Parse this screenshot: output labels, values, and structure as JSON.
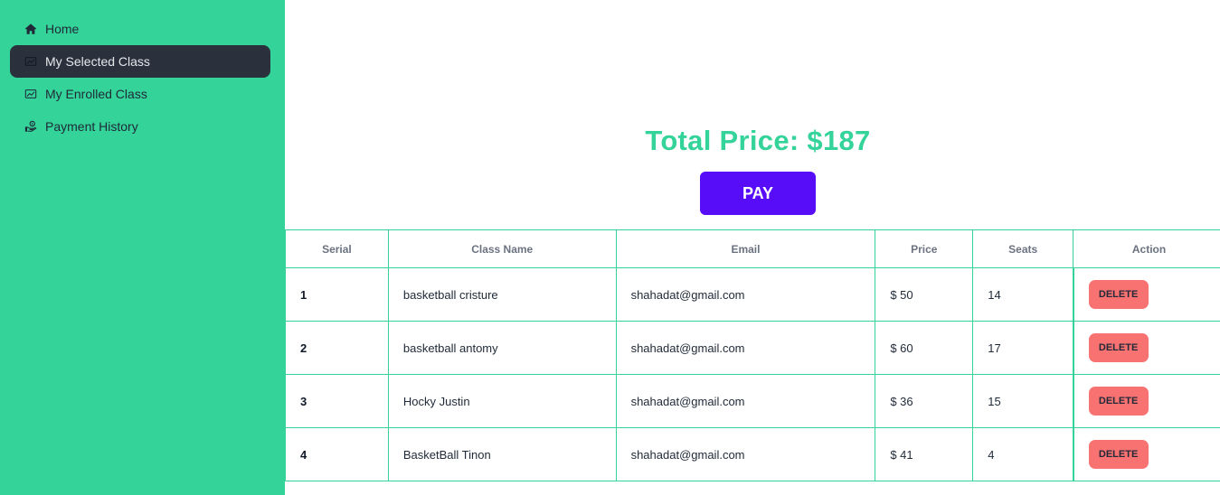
{
  "sidebar": {
    "items": [
      {
        "label": "Home",
        "icon": "home-icon",
        "active": false
      },
      {
        "label": "My Selected Class",
        "icon": "chart-icon",
        "active": true
      },
      {
        "label": "My Enrolled Class",
        "icon": "chart-icon",
        "active": false
      },
      {
        "label": "Payment History",
        "icon": "hand-coins-icon",
        "active": false
      }
    ]
  },
  "summary": {
    "total_label": "Total Price: $187",
    "pay_label": "PAY"
  },
  "table": {
    "headers": [
      "Serial",
      "Class Name",
      "Email",
      "Price",
      "Seats",
      "Action"
    ],
    "rows": [
      {
        "serial": "1",
        "class_name": "basketball cristure",
        "email": "shahadat@gmail.com",
        "price": "$ 50",
        "seats": "14",
        "action": "DELETE"
      },
      {
        "serial": "2",
        "class_name": "basketball antomy",
        "email": "shahadat@gmail.com",
        "price": "$ 60",
        "seats": "17",
        "action": "DELETE"
      },
      {
        "serial": "3",
        "class_name": "Hocky Justin",
        "email": "shahadat@gmail.com",
        "price": "$ 36",
        "seats": "15",
        "action": "DELETE"
      },
      {
        "serial": "4",
        "class_name": "BasketBall Tinon",
        "email": "shahadat@gmail.com",
        "price": "$ 41",
        "seats": "4",
        "action": "DELETE"
      }
    ]
  },
  "colors": {
    "sidebar_bg": "#34d399",
    "active_item_bg": "#2a303c",
    "accent": "#34d399",
    "pay_button": "#570df8",
    "delete_button": "#f87272"
  }
}
